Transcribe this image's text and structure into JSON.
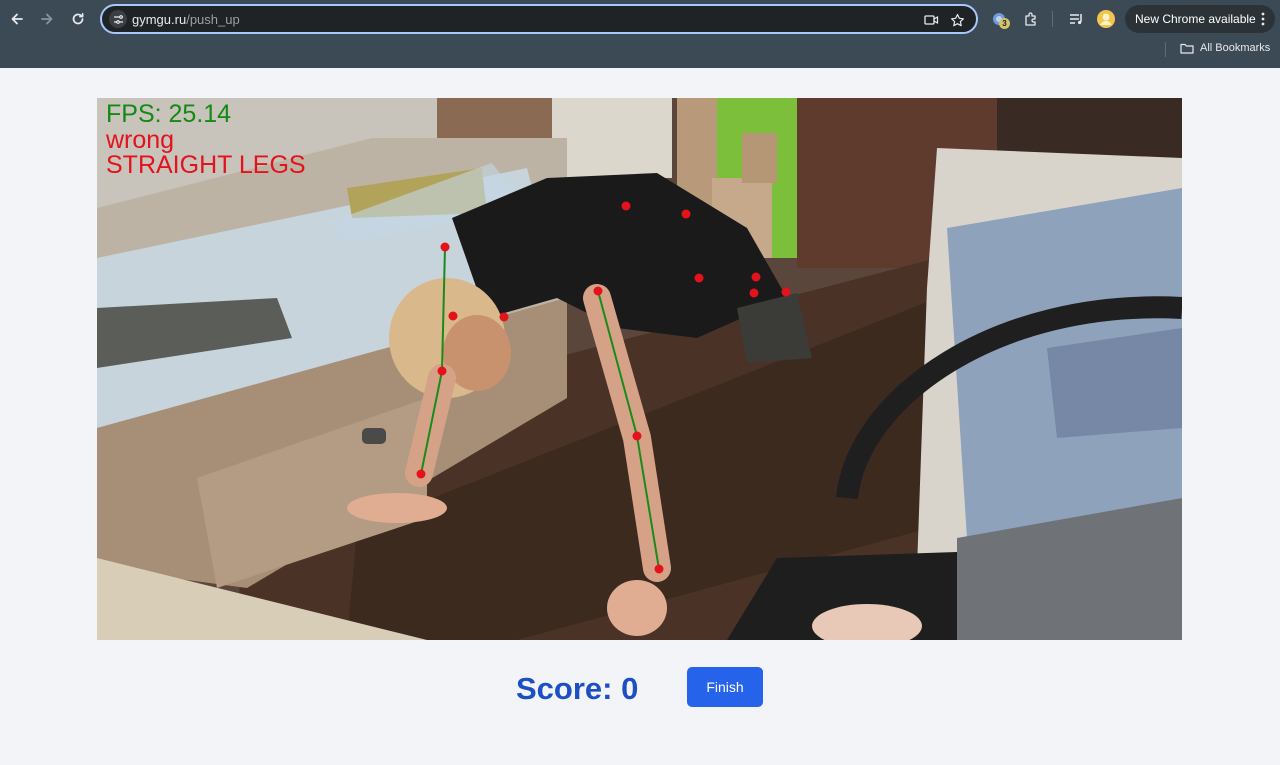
{
  "browser": {
    "url_host": "gymgu.ru",
    "url_path": "/push_up",
    "extension_badge": "3",
    "update_button_label": "New Chrome available",
    "bookmarks_label": "All Bookmarks"
  },
  "video": {
    "fps_text": "FPS: 25.14",
    "status_text": "wrong",
    "error_text": "STRAIGHT LEGS",
    "fps_color": "#138a13",
    "error_color": "#e3121b",
    "keypoint_color": "#e3121b",
    "skeleton_color": "#1a8a1a"
  },
  "workout": {
    "score_text": "Score: 0",
    "finish_label": "Finish",
    "score_color": "#1d4fc4",
    "button_color": "#2563eb"
  }
}
